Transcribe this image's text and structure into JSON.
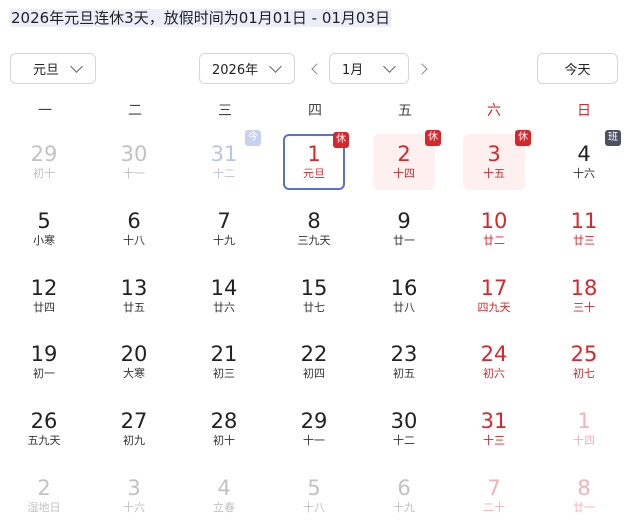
{
  "headline": {
    "text": "2026年元旦连休3天，放假时间为01月01日 - 01月03日"
  },
  "toolbar": {
    "type_select": "元旦",
    "year_select": "2026年",
    "month_select": "1月",
    "today_label": "今天"
  },
  "weekdays": [
    "一",
    "二",
    "三",
    "四",
    "五",
    "六",
    "日"
  ],
  "colors": {
    "red": "#d8262b",
    "selected_border": "#5a6fd2",
    "holiday_bg": "#fdf0ee",
    "work_badge": "#4a5264"
  },
  "days": [
    {
      "num": "29",
      "lunar": "初十",
      "other": true
    },
    {
      "num": "30",
      "lunar": "十一",
      "other": true
    },
    {
      "num": "31",
      "lunar": "十二",
      "other": true,
      "today": true,
      "badge": "今",
      "badge_type": "today"
    },
    {
      "num": "1",
      "lunar": "元旦",
      "red": true,
      "selected": true,
      "badge": "休",
      "badge_type": "rest"
    },
    {
      "num": "2",
      "lunar": "十四",
      "red": true,
      "holiday": true,
      "badge": "休",
      "badge_type": "rest"
    },
    {
      "num": "3",
      "lunar": "十五",
      "red": true,
      "holiday": true,
      "badge": "休",
      "badge_type": "rest"
    },
    {
      "num": "4",
      "lunar": "十六",
      "badge": "班",
      "badge_type": "work"
    },
    {
      "num": "5",
      "lunar": "小寒"
    },
    {
      "num": "6",
      "lunar": "十八"
    },
    {
      "num": "7",
      "lunar": "十九"
    },
    {
      "num": "8",
      "lunar": "三九天"
    },
    {
      "num": "9",
      "lunar": "廿一"
    },
    {
      "num": "10",
      "lunar": "廿二",
      "red": true
    },
    {
      "num": "11",
      "lunar": "廿三",
      "red": true
    },
    {
      "num": "12",
      "lunar": "廿四"
    },
    {
      "num": "13",
      "lunar": "廿五"
    },
    {
      "num": "14",
      "lunar": "廿六"
    },
    {
      "num": "15",
      "lunar": "廿七"
    },
    {
      "num": "16",
      "lunar": "廿八"
    },
    {
      "num": "17",
      "lunar": "四九天",
      "red": true
    },
    {
      "num": "18",
      "lunar": "三十",
      "red": true
    },
    {
      "num": "19",
      "lunar": "初一"
    },
    {
      "num": "20",
      "lunar": "大寒"
    },
    {
      "num": "21",
      "lunar": "初三"
    },
    {
      "num": "22",
      "lunar": "初四"
    },
    {
      "num": "23",
      "lunar": "初五"
    },
    {
      "num": "24",
      "lunar": "初六",
      "red": true
    },
    {
      "num": "25",
      "lunar": "初七",
      "red": true
    },
    {
      "num": "26",
      "lunar": "五九天"
    },
    {
      "num": "27",
      "lunar": "初九"
    },
    {
      "num": "28",
      "lunar": "初十"
    },
    {
      "num": "29",
      "lunar": "十一"
    },
    {
      "num": "30",
      "lunar": "十二"
    },
    {
      "num": "31",
      "lunar": "十三",
      "red": true
    },
    {
      "num": "1",
      "lunar": "十四",
      "red": true,
      "other": true
    },
    {
      "num": "2",
      "lunar": "湿地日",
      "other": true
    },
    {
      "num": "3",
      "lunar": "十六",
      "other": true
    },
    {
      "num": "4",
      "lunar": "立春",
      "other": true
    },
    {
      "num": "5",
      "lunar": "十八",
      "other": true
    },
    {
      "num": "6",
      "lunar": "十九",
      "other": true
    },
    {
      "num": "7",
      "lunar": "二十",
      "red": true,
      "other": true
    },
    {
      "num": "8",
      "lunar": "廿一",
      "red": true,
      "other": true
    }
  ]
}
